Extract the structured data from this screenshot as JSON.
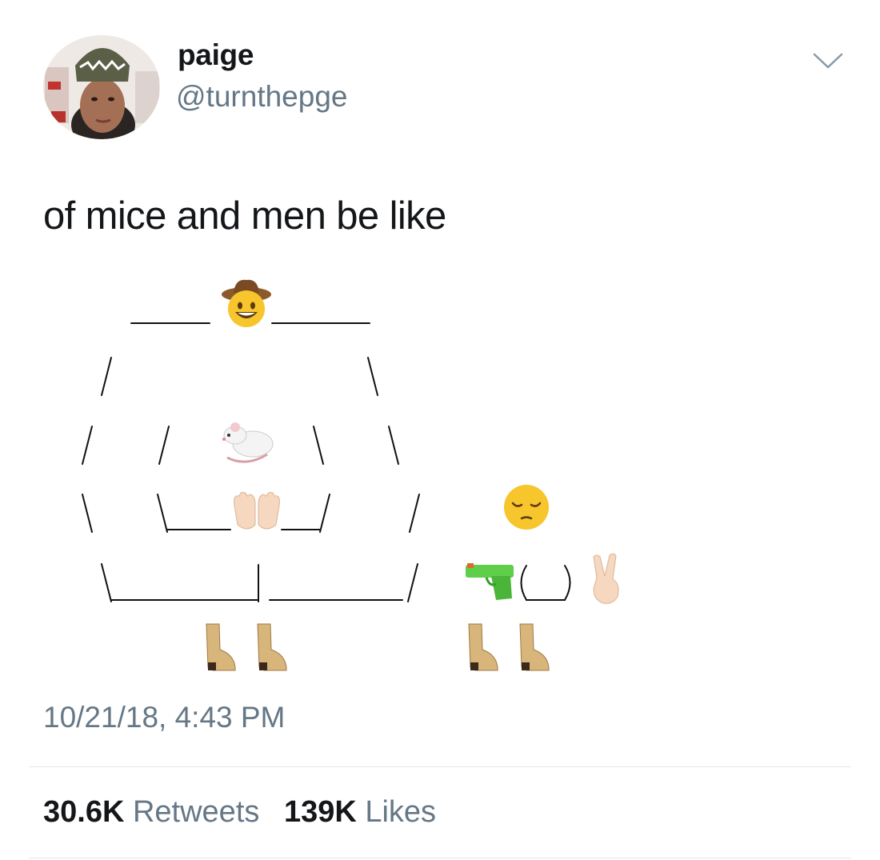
{
  "tweet": {
    "display_name": "paige",
    "handle": "@turnthepge",
    "text": "of mice and men be like",
    "timestamp": "10/21/18, 4:43 PM",
    "retweets_count": "30.6K",
    "retweets_label": "Retweets",
    "likes_count": "139K",
    "likes_label": "Likes"
  },
  "icons": {
    "menu": "chevron-down-icon",
    "avatar": "profile-photo",
    "art": [
      "cowboy-hat-face-emoji",
      "rat-emoji",
      "palms-up-together-emoji",
      "pensive-face-emoji",
      "water-pistol-emoji",
      "victory-hand-emoji",
      "cowboy-boot-emoji"
    ]
  },
  "colors": {
    "text": "#14171a",
    "secondary": "#657786",
    "divider": "#e1e8ed"
  }
}
